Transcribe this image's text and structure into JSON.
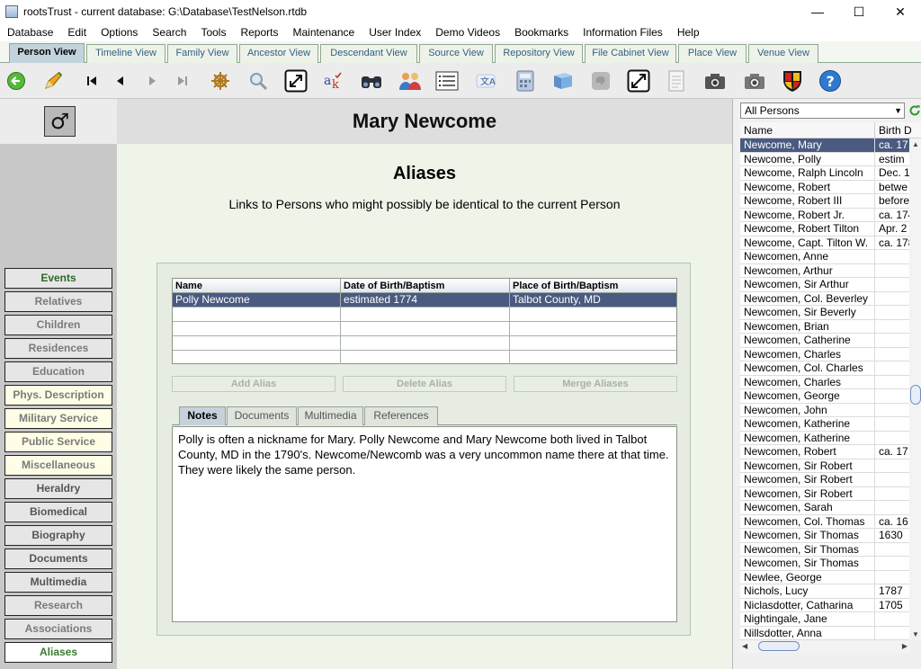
{
  "window": {
    "title": "rootsTrust - current database: G:\\Database\\TestNelson.rtdb"
  },
  "menu": [
    "Database",
    "Edit",
    "Options",
    "Search",
    "Tools",
    "Reports",
    "Maintenance",
    "User Index",
    "Demo Videos",
    "Bookmarks",
    "Information Files",
    "Help"
  ],
  "view_tabs": [
    "Person View",
    "Timeline View",
    "Family View",
    "Ancestor View",
    "Descendant View",
    "Source View",
    "Repository View",
    "File Cabinet View",
    "Place View",
    "Venue View"
  ],
  "toolbar_icons": [
    "back-arrow-icon",
    "pencil-icon",
    "first-record-icon",
    "previous-record-icon",
    "next-record-icon",
    "last-record-icon",
    "ship-wheel-icon",
    "search-gear-icon",
    "expand-icon",
    "spelling-icon",
    "binoculars-icon",
    "people-icon",
    "list-icon",
    "translate-icon",
    "calculator-icon",
    "book-icon",
    "speech-bubble-icon",
    "fullscreen-icon",
    "document-icon",
    "camera-icon",
    "camera-alt-icon",
    "coat-of-arms-icon",
    "help-icon"
  ],
  "person": {
    "name": "Mary Newcome",
    "gender_symbol": "♂"
  },
  "sidebar": {
    "items": [
      "Events",
      "Relatives",
      "Children",
      "Residences",
      "Education",
      "Phys. Description",
      "Military Service",
      "Public Service",
      "Miscellaneous",
      "Heraldry",
      "Biomedical",
      "Biography",
      "Documents",
      "Multimedia",
      "Research",
      "Associations",
      "Aliases"
    ]
  },
  "aliases": {
    "title": "Aliases",
    "subtitle": "Links to Persons who might possibly be identical to the current Person",
    "columns": [
      "Name",
      "Date of Birth/Baptism",
      "Place of Birth/Baptism"
    ],
    "rows": [
      {
        "name": "Polly Newcome",
        "date": "estimated 1774",
        "place": "Talbot County, MD"
      }
    ],
    "buttons": {
      "add": "Add Alias",
      "delete": "Delete Alias",
      "merge": "Merge Aliases"
    },
    "subtabs": [
      "Notes",
      "Documents",
      "Multimedia",
      "References"
    ],
    "notes": "Polly is often a nickname for Mary. Polly Newcome and Mary Newcome both lived in Talbot County, MD in the 1790's. Newcome/Newcomb was a very uncommon name there at that time. They were likely the same person."
  },
  "person_list": {
    "filter": "All Persons",
    "columns": [
      "Name",
      "Birth D"
    ],
    "rows": [
      {
        "name": "Newcome, Mary",
        "date": "ca. 17",
        "selected": true
      },
      {
        "name": "Newcome, Polly",
        "date": "estim"
      },
      {
        "name": "Newcome, Ralph Lincoln",
        "date": "Dec. 1"
      },
      {
        "name": "Newcome, Robert",
        "date": "betwe"
      },
      {
        "name": "Newcome, Robert III",
        "date": "before"
      },
      {
        "name": "Newcome, Robert Jr.",
        "date": "ca. 174"
      },
      {
        "name": "Newcome, Robert Tilton",
        "date": "Apr. 2"
      },
      {
        "name": "Newcome, Capt. Tilton W.",
        "date": "ca. 178"
      },
      {
        "name": "Newcomen, Anne",
        "date": ""
      },
      {
        "name": "Newcomen, Arthur",
        "date": ""
      },
      {
        "name": "Newcomen, Sir Arthur",
        "date": ""
      },
      {
        "name": "Newcomen, Col. Beverley",
        "date": ""
      },
      {
        "name": "Newcomen, Sir Beverly",
        "date": ""
      },
      {
        "name": "Newcomen, Brian",
        "date": ""
      },
      {
        "name": "Newcomen, Catherine",
        "date": ""
      },
      {
        "name": "Newcomen, Charles",
        "date": ""
      },
      {
        "name": "Newcomen, Col. Charles",
        "date": ""
      },
      {
        "name": "Newcomen, Charles",
        "date": ""
      },
      {
        "name": "Newcomen, George",
        "date": ""
      },
      {
        "name": "Newcomen, John",
        "date": ""
      },
      {
        "name": "Newcomen, Katherine",
        "date": ""
      },
      {
        "name": "Newcomen, Katherine",
        "date": ""
      },
      {
        "name": "Newcomen, Robert",
        "date": "ca. 17"
      },
      {
        "name": "Newcomen, Sir Robert",
        "date": ""
      },
      {
        "name": "Newcomen, Sir Robert",
        "date": ""
      },
      {
        "name": "Newcomen, Sir Robert",
        "date": ""
      },
      {
        "name": "Newcomen, Sarah",
        "date": ""
      },
      {
        "name": "Newcomen, Col. Thomas",
        "date": "ca. 16"
      },
      {
        "name": "Newcomen, Sir Thomas",
        "date": "1630"
      },
      {
        "name": "Newcomen, Sir Thomas",
        "date": ""
      },
      {
        "name": "Newcomen, Sir Thomas",
        "date": ""
      },
      {
        "name": "Newlee, George",
        "date": ""
      },
      {
        "name": "Nichols, Lucy",
        "date": "1787"
      },
      {
        "name": "Niclasdotter, Catharina",
        "date": "1705"
      },
      {
        "name": "Nightingale, Jane",
        "date": ""
      },
      {
        "name": "Nillsdotter, Anna",
        "date": ""
      }
    ]
  },
  "colors": {
    "selection": "#4a5a80",
    "accent_green": "#2c6a2c",
    "tab_text": "#355f80"
  }
}
